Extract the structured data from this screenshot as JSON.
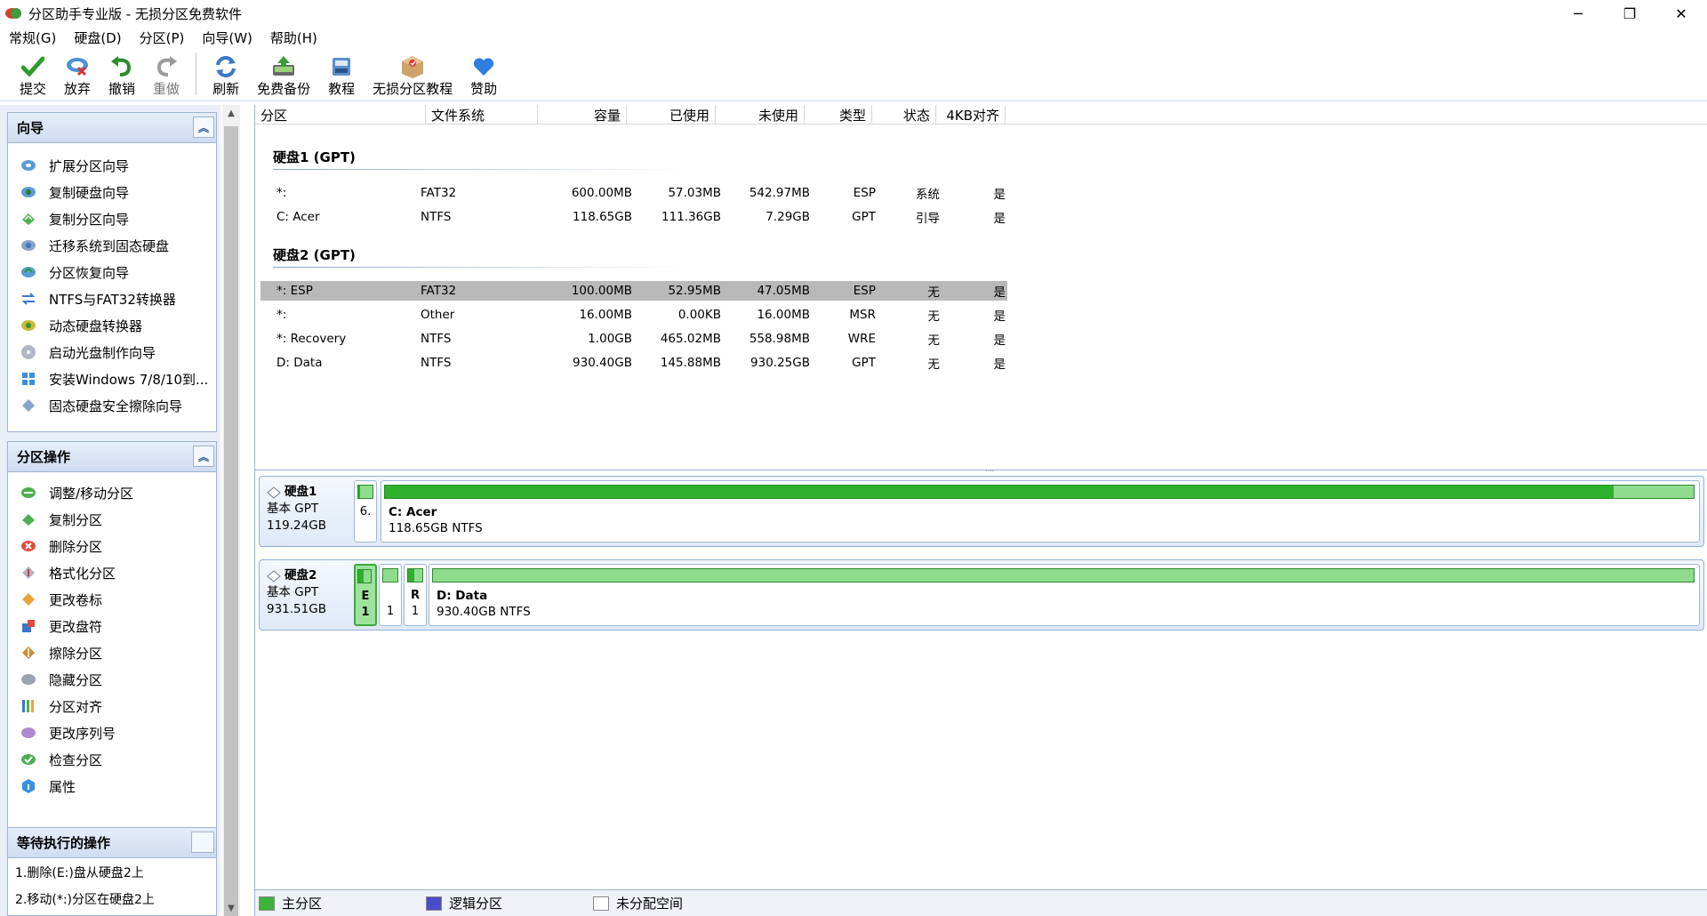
{
  "window": {
    "title": "分区助手专业版 - 无损分区免费软件",
    "controls": [
      "─",
      "❐",
      "✕"
    ]
  },
  "menu": [
    "常规(G)",
    "硬盘(D)",
    "分区(P)",
    "向导(W)",
    "帮助(H)"
  ],
  "toolbar": {
    "submit": "提交",
    "discard": "放弃",
    "undo": "撤销",
    "redo": "重做",
    "refresh": "刷新",
    "backup": "免费备份",
    "tutorial": "教程",
    "lossless_tutorial": "无损分区教程",
    "donate": "赞助"
  },
  "wizard_panel": {
    "title": "向导",
    "items": [
      "扩展分区向导",
      "复制硬盘向导",
      "复制分区向导",
      "迁移系统到固态硬盘",
      "分区恢复向导",
      "NTFS与FAT32转换器",
      "动态硬盘转换器",
      "启动光盘制作向导",
      "安装Windows 7/8/10到...",
      "固态硬盘安全擦除向导"
    ]
  },
  "ops_panel": {
    "title": "分区操作",
    "items": [
      "调整/移动分区",
      "复制分区",
      "删除分区",
      "格式化分区",
      "更改卷标",
      "更改盘符",
      "擦除分区",
      "隐藏分区",
      "分区对齐",
      "更改序列号",
      "检查分区",
      "属性"
    ]
  },
  "pending_panel": {
    "title": "等待执行的操作",
    "items": [
      "1.删除(E:)盘从硬盘2上",
      "2.移动(*:)分区在硬盘2上"
    ]
  },
  "table": {
    "headers": {
      "partition": "分区",
      "filesystem": "文件系统",
      "capacity": "容量",
      "used": "已使用",
      "unused": "未使用",
      "type": "类型",
      "status": "状态",
      "align4k": "4KB对齐"
    },
    "disk1": {
      "title": "硬盘1 (GPT)",
      "rows": [
        {
          "name": "*:",
          "fs": "FAT32",
          "cap": "600.00MB",
          "used": "57.03MB",
          "unused": "542.97MB",
          "type": "ESP",
          "status": "系统",
          "align": "是"
        },
        {
          "name": "C: Acer",
          "fs": "NTFS",
          "cap": "118.65GB",
          "used": "111.36GB",
          "unused": "7.29GB",
          "type": "GPT",
          "status": "引导",
          "align": "是"
        }
      ]
    },
    "disk2": {
      "title": "硬盘2 (GPT)",
      "rows": [
        {
          "name": "*: ESP",
          "fs": "FAT32",
          "cap": "100.00MB",
          "used": "52.95MB",
          "unused": "47.05MB",
          "type": "ESP",
          "status": "无",
          "align": "是"
        },
        {
          "name": "*:",
          "fs": "Other",
          "cap": "16.00MB",
          "used": "0.00KB",
          "unused": "16.00MB",
          "type": "MSR",
          "status": "无",
          "align": "是"
        },
        {
          "name": "*: Recovery",
          "fs": "NTFS",
          "cap": "1.00GB",
          "used": "465.02MB",
          "unused": "558.98MB",
          "type": "WRE",
          "status": "无",
          "align": "是"
        },
        {
          "name": "D: Data",
          "fs": "NTFS",
          "cap": "930.40GB",
          "used": "145.88MB",
          "unused": "930.25GB",
          "type": "GPT",
          "status": "无",
          "align": "是"
        }
      ]
    }
  },
  "diskmap": {
    "disk1": {
      "name": "硬盘1",
      "kind": "基本 GPT",
      "size": "119.24GB",
      "small_part_label": "6.",
      "main_part_name": "C: Acer",
      "main_part_info": "118.65GB NTFS",
      "main_part_used_fraction": 0.939
    },
    "disk2": {
      "name": "硬盘2",
      "kind": "基本 GPT",
      "size": "931.51GB",
      "p1_top": "E",
      "p1_bottom": "1",
      "p2_bottom": "1",
      "p3_top": "R",
      "p3_bottom": "1",
      "main_part_name": "D: Data",
      "main_part_info": "930.40GB NTFS",
      "main_part_used_fraction": 0.0
    }
  },
  "legend": {
    "primary": "主分区",
    "logical": "逻辑分区",
    "unallocated": "未分配空间"
  },
  "colors": {
    "primary": "#3cb33c",
    "logical": "#4b4bc7",
    "unallocated": "#ffffff",
    "selected_row": "#b9b9b9"
  }
}
